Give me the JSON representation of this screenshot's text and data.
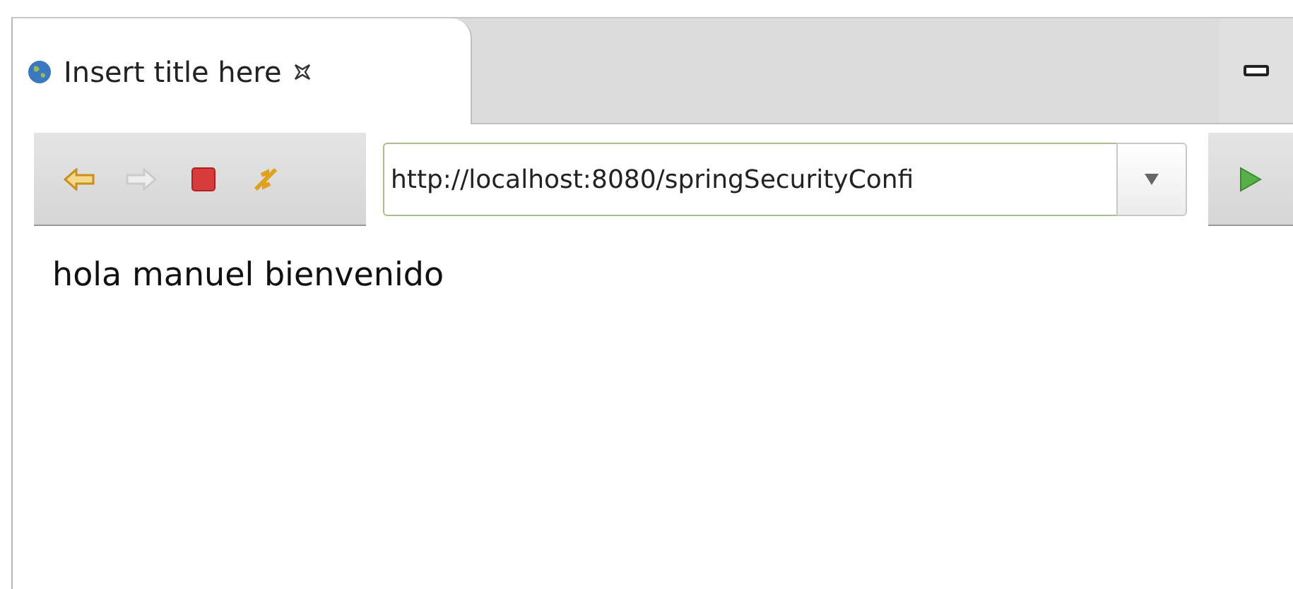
{
  "tabs": [
    {
      "label": "Insert title here",
      "selected": true
    }
  ],
  "toolbar": {
    "buttons": [
      {
        "kind": "back",
        "disabled": false
      },
      {
        "kind": "forward",
        "disabled": true
      },
      {
        "kind": "stop",
        "disabled": false
      },
      {
        "kind": "refresh",
        "disabled": false
      }
    ]
  },
  "url_field": {
    "value": "http://localhost:8080/springSecurityConfi"
  },
  "content": {
    "text": "hola manuel bienvenido"
  }
}
